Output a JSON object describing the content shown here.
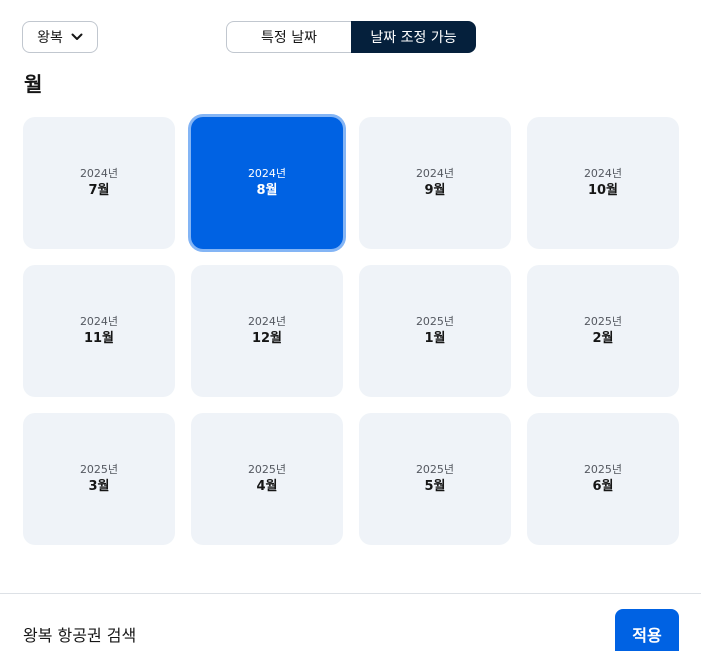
{
  "trip_type": {
    "selected": "왕복",
    "icon": "chevron-down-icon"
  },
  "date_mode": {
    "specific_label": "특정 날짜",
    "flexible_label": "날짜 조정 가능",
    "active": "flexible"
  },
  "section_title": "월",
  "months": [
    {
      "year": "2024년",
      "month": "7월",
      "selected": false
    },
    {
      "year": "2024년",
      "month": "8월",
      "selected": true
    },
    {
      "year": "2024년",
      "month": "9월",
      "selected": false
    },
    {
      "year": "2024년",
      "month": "10월",
      "selected": false
    },
    {
      "year": "2024년",
      "month": "11월",
      "selected": false
    },
    {
      "year": "2024년",
      "month": "12월",
      "selected": false
    },
    {
      "year": "2025년",
      "month": "1월",
      "selected": false
    },
    {
      "year": "2025년",
      "month": "2월",
      "selected": false
    },
    {
      "year": "2025년",
      "month": "3월",
      "selected": false
    },
    {
      "year": "2025년",
      "month": "4월",
      "selected": false
    },
    {
      "year": "2025년",
      "month": "5월",
      "selected": false
    },
    {
      "year": "2025년",
      "month": "6월",
      "selected": false
    }
  ],
  "footer": {
    "label": "왕복 항공권 검색",
    "apply_label": "적용"
  },
  "colors": {
    "accent": "#0062e3",
    "dark": "#05203c",
    "tile": "#eff3f8"
  }
}
